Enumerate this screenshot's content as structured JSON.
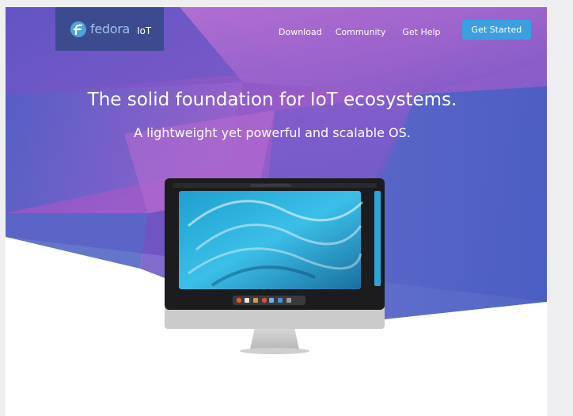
{
  "brand": {
    "logo_text": "fedora",
    "edition": "IoT",
    "logo_icon": "fedora-infinity-icon"
  },
  "nav": {
    "items": [
      {
        "label": "Download"
      },
      {
        "label": "Community"
      },
      {
        "label": "Get Help"
      }
    ],
    "cta_label": "Get Started"
  },
  "hero": {
    "title": "The solid foundation for IoT ecosystems.",
    "subtitle": "A lightweight yet powerful and scalable OS."
  },
  "device": {
    "type": "desktop-monitor-icon",
    "dock_apps": [
      "firefox-icon",
      "files-icon",
      "software-icon",
      "chrome-icon",
      "text-editor-icon",
      "help-icon",
      "app-grid-icon"
    ]
  },
  "colors": {
    "accent": "#3c9fe0",
    "brand_box": "#3c4a8f",
    "hero_purple": "#8a4fb8",
    "hero_blue": "#4a5fc4",
    "hero_magenta": "#c46ad0"
  }
}
